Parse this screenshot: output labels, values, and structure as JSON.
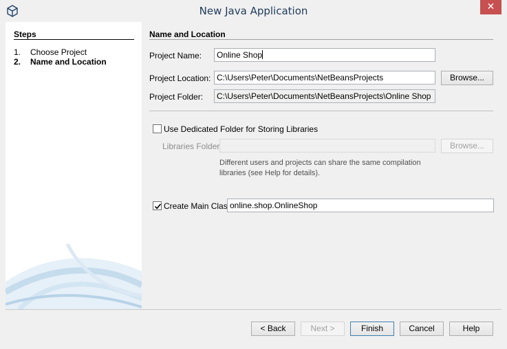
{
  "window": {
    "title": "New Java Application",
    "close_glyph": "✕",
    "app_icon": "netbeans-cube-icon"
  },
  "steps": {
    "title": "Steps",
    "items": [
      {
        "num": "1.",
        "label": "Choose Project",
        "current": false
      },
      {
        "num": "2.",
        "label": "Name and Location",
        "current": true
      }
    ]
  },
  "main": {
    "section_title": "Name and Location",
    "project_name": {
      "label": "Project Name:",
      "value": "Online Shop"
    },
    "project_location": {
      "label": "Project Location:",
      "value": "C:\\Users\\Peter\\Documents\\NetBeansProjects",
      "browse": "Browse..."
    },
    "project_folder": {
      "label": "Project Folder:",
      "value": "C:\\Users\\Peter\\Documents\\NetBeansProjects\\Online Shop"
    },
    "dedicated_folder": {
      "label": "Use Dedicated Folder for Storing Libraries",
      "checked": false
    },
    "libraries_folder": {
      "label": "Libraries Folder:",
      "value": "",
      "browse": "Browse..."
    },
    "note": {
      "line1": "Different users and projects can share the same compilation",
      "line2": "libraries (see Help for details)."
    },
    "create_main_class": {
      "label": "Create Main Class",
      "checked": true,
      "value": "online.shop.OnlineShop"
    }
  },
  "buttons": {
    "back": "< Back",
    "next": "Next >",
    "finish": "Finish",
    "cancel": "Cancel",
    "help": "Help"
  }
}
